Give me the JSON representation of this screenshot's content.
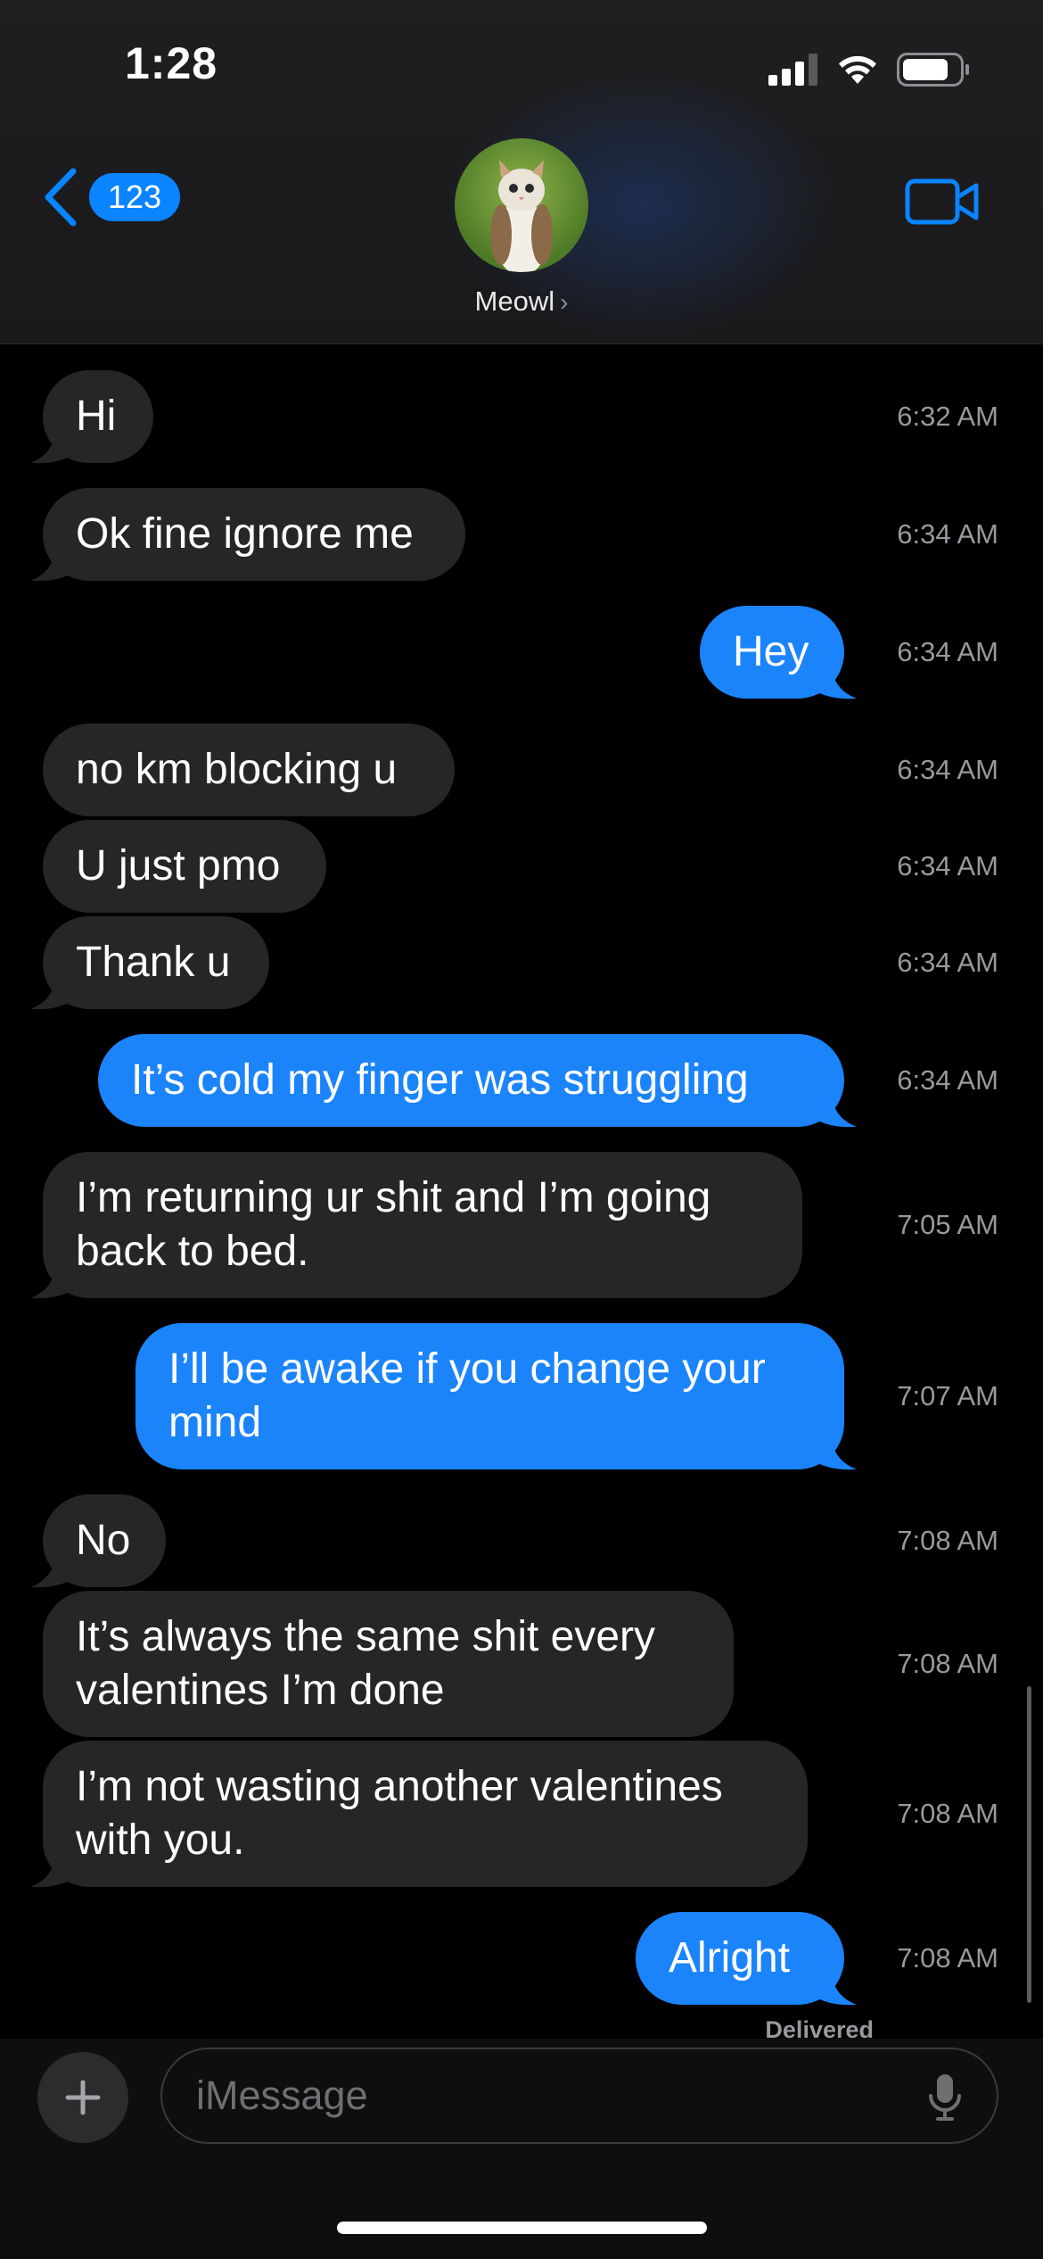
{
  "status_bar": {
    "time": "1:28"
  },
  "header": {
    "back_badge": "123",
    "contact_name": "Meowl",
    "contact_chevron": "›"
  },
  "messages": [
    {
      "from": "them",
      "text": "Hi",
      "time": "6:32 AM"
    },
    {
      "from": "them",
      "text": "Ok fine ignore me",
      "time": "6:34 AM"
    },
    {
      "from": "me",
      "text": "Hey",
      "time": "6:34 AM"
    },
    {
      "from": "them",
      "text": "no km blocking u",
      "time": "6:34 AM"
    },
    {
      "from": "them",
      "text": "U just pmo",
      "time": "6:34 AM"
    },
    {
      "from": "them",
      "text": "Thank u",
      "time": "6:34 AM"
    },
    {
      "from": "me",
      "text": "It’s cold my finger was struggling",
      "time": "6:34 AM"
    },
    {
      "from": "them",
      "text": "I’m returning ur shit and I’m going back to bed.",
      "time": "7:05 AM"
    },
    {
      "from": "me",
      "text": "I’ll be awake if you change your mind",
      "time": "7:07 AM"
    },
    {
      "from": "them",
      "text": "No",
      "time": "7:08 AM"
    },
    {
      "from": "them",
      "text": "It’s always the same shit every valentines I’m done",
      "time": "7:08 AM"
    },
    {
      "from": "them",
      "text": "I’m not wasting another valentines with you.",
      "time": "7:08 AM"
    },
    {
      "from": "me",
      "text": "Alright",
      "time": "7:08 AM"
    }
  ],
  "delivered_label": "Delivered",
  "composer": {
    "placeholder": "iMessage"
  },
  "colors": {
    "incoming_bubble": "#262629",
    "outgoing_bubble": "#1b84fb",
    "accent": "#0a84ff"
  },
  "icons": [
    "back-chevron-icon",
    "signal-icon",
    "wifi-icon",
    "battery-icon",
    "video-call-icon",
    "plus-icon",
    "mic-icon"
  ]
}
